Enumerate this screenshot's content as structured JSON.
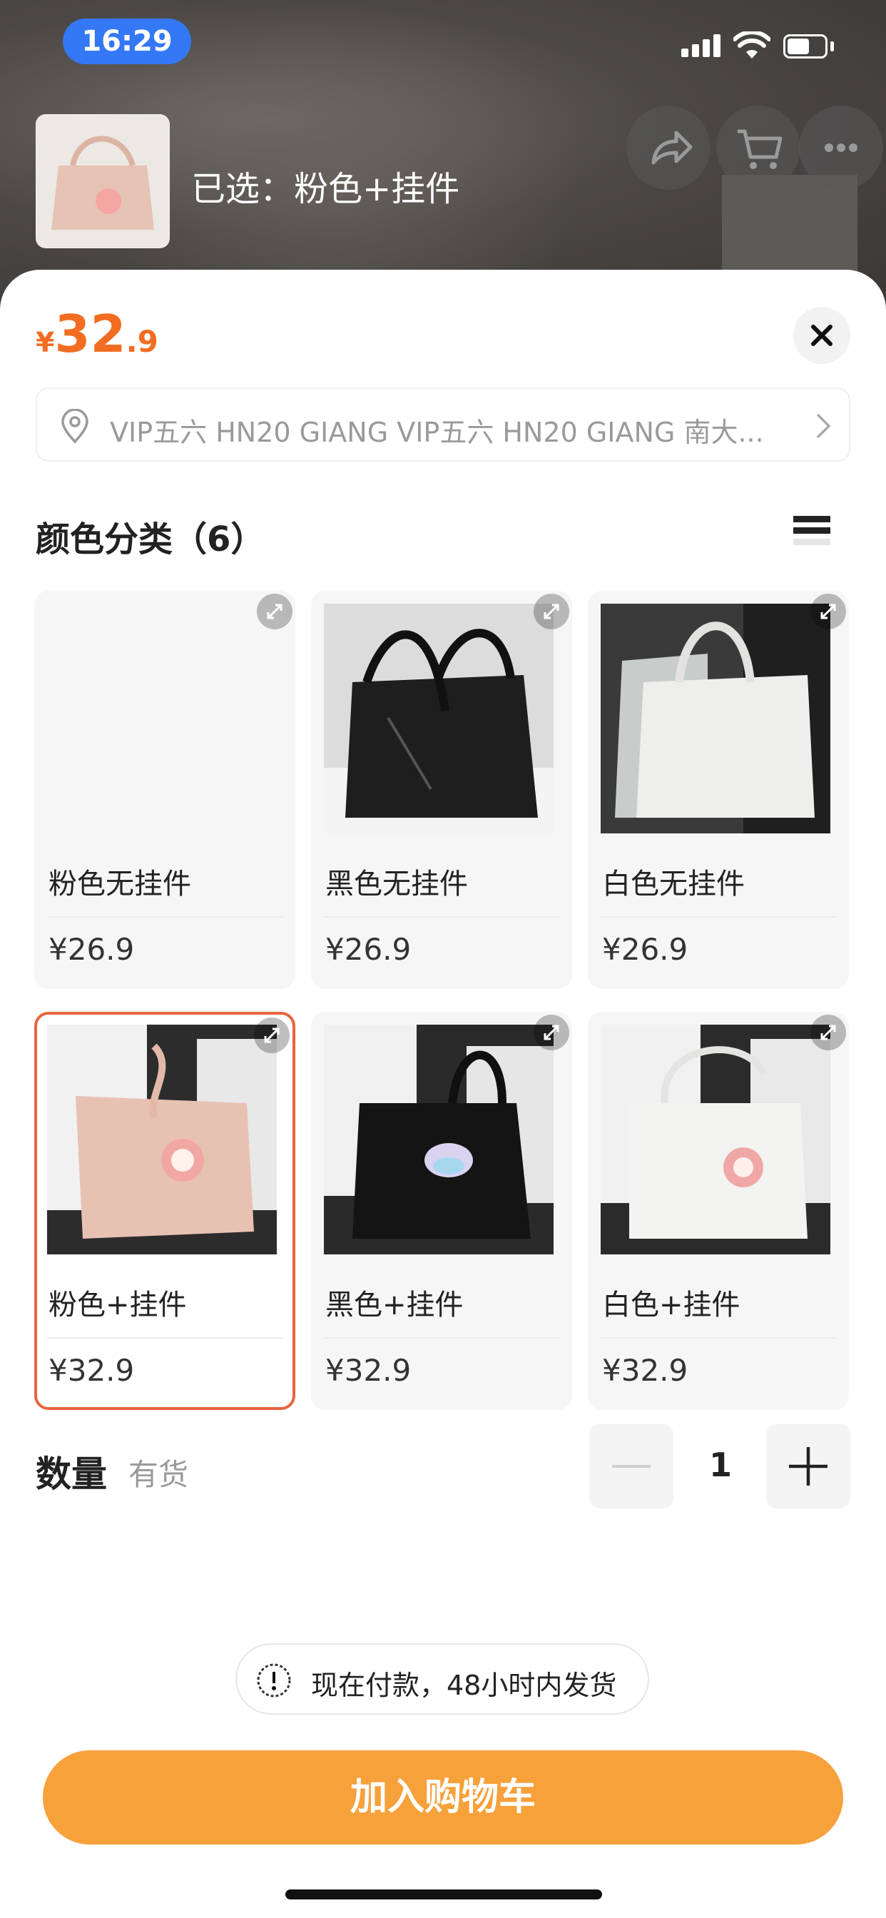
{
  "status_bar": {
    "time": "16:29"
  },
  "header": {
    "selected_label": "已选：粉色+挂件"
  },
  "top_icons": [
    "share-icon",
    "cart-icon",
    "more-icon"
  ],
  "price": {
    "currency": "¥",
    "integer": "32",
    "decimal": ".9"
  },
  "address": {
    "text": "VIP五六 HN20 GIANG VIP五六 HN20 GIANG 南大..."
  },
  "section": {
    "title": "颜色分类（6）"
  },
  "variants": [
    {
      "name": "粉色无挂件",
      "price": "¥26.9",
      "color": "pink",
      "charm": false,
      "selected": false,
      "image_loaded": false
    },
    {
      "name": "黑色无挂件",
      "price": "¥26.9",
      "color": "black",
      "charm": false,
      "selected": false,
      "image_loaded": true
    },
    {
      "name": "白色无挂件",
      "price": "¥26.9",
      "color": "white",
      "charm": false,
      "selected": false,
      "image_loaded": true
    },
    {
      "name": "粉色+挂件",
      "price": "¥32.9",
      "color": "pink",
      "charm": true,
      "selected": true,
      "image_loaded": true
    },
    {
      "name": "黑色+挂件",
      "price": "¥32.9",
      "color": "black",
      "charm": true,
      "selected": false,
      "image_loaded": true
    },
    {
      "name": "白色+挂件",
      "price": "¥32.9",
      "color": "white",
      "charm": true,
      "selected": false,
      "image_loaded": true
    }
  ],
  "quantity": {
    "label": "数量",
    "stock": "有货",
    "value": "1"
  },
  "notice": {
    "text": "现在付款，48小时内发货"
  },
  "cta": {
    "label": "加入购物车"
  },
  "colors": {
    "accent": "#f26d21",
    "selected_border": "#e8643c",
    "cta": "#f7a13b",
    "time_pill": "#3478f6"
  }
}
